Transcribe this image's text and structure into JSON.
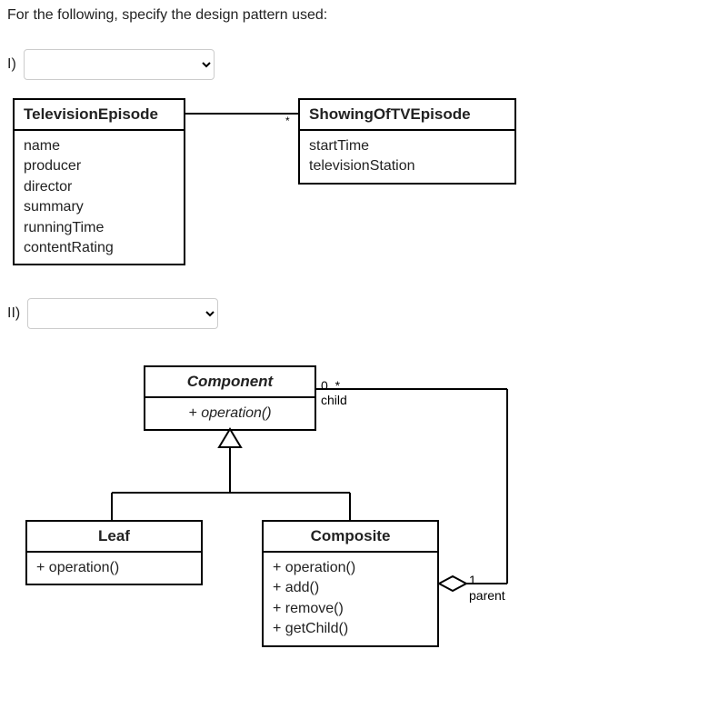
{
  "question": {
    "prompt": "For the following, specify the design pattern used:",
    "parts": {
      "one_label": "I)",
      "two_label": "II)"
    }
  },
  "diagram1": {
    "box_a": {
      "title": "TelevisionEpisode",
      "attrs": [
        "name",
        "producer",
        "director",
        "summary",
        "runningTime",
        "contentRating"
      ]
    },
    "box_b": {
      "title": "ShowingOfTVEpisode",
      "attrs": [
        "startTime",
        "televisionStation"
      ]
    },
    "assoc_multiplicity": "*"
  },
  "diagram2": {
    "component": {
      "title": "Component",
      "ops": [
        "+   operation()"
      ]
    },
    "leaf": {
      "title": "Leaf",
      "ops": [
        "+   operation()"
      ]
    },
    "composite": {
      "title": "Composite",
      "ops": [
        "+   operation()",
        "+   add()",
        "+   remove()",
        "+   getChild()"
      ]
    },
    "child_mult": "0..*",
    "child_role": "child",
    "parent_mult": "1",
    "parent_role": "parent"
  }
}
